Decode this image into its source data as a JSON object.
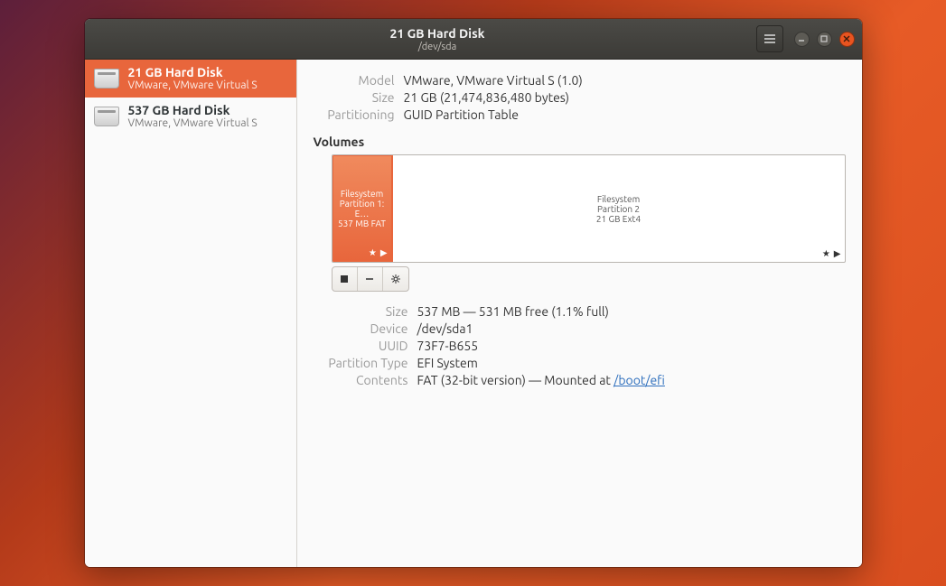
{
  "title": {
    "main": "21 GB Hard Disk",
    "sub": "/dev/sda"
  },
  "sidebar": {
    "disks": [
      {
        "title": "21 GB Hard Disk",
        "sub": "VMware, VMware Virtual S",
        "selected": true
      },
      {
        "title": "537 GB Hard Disk",
        "sub": "VMware, VMware Virtual S",
        "selected": false
      }
    ]
  },
  "overview": {
    "model_label": "Model",
    "model_value": "VMware, VMware Virtual S (1.0)",
    "size_label": "Size",
    "size_value": "21 GB (21,474,836,480 bytes)",
    "partitioning_label": "Partitioning",
    "partitioning_value": "GUID Partition Table"
  },
  "volumes": {
    "heading": "Volumes",
    "parts": [
      {
        "line1": "Filesystem",
        "line2": "Partition 1: E…",
        "line3": "537 MB FAT",
        "width_pct": 12,
        "selected": true
      },
      {
        "line1": "Filesystem",
        "line2": "Partition 2",
        "line3": "21 GB Ext4",
        "width_pct": 88,
        "selected": false
      }
    ]
  },
  "partition_detail": {
    "size_label": "Size",
    "size_value": "537 MB — 531 MB free (1.1% full)",
    "device_label": "Device",
    "device_value": "/dev/sda1",
    "uuid_label": "UUID",
    "uuid_value": "73F7-B655",
    "ptype_label": "Partition Type",
    "ptype_value": "EFI System",
    "contents_label": "Contents",
    "contents_prefix": "FAT (32-bit version) — Mounted at ",
    "mount_point": "/boot/efi"
  }
}
